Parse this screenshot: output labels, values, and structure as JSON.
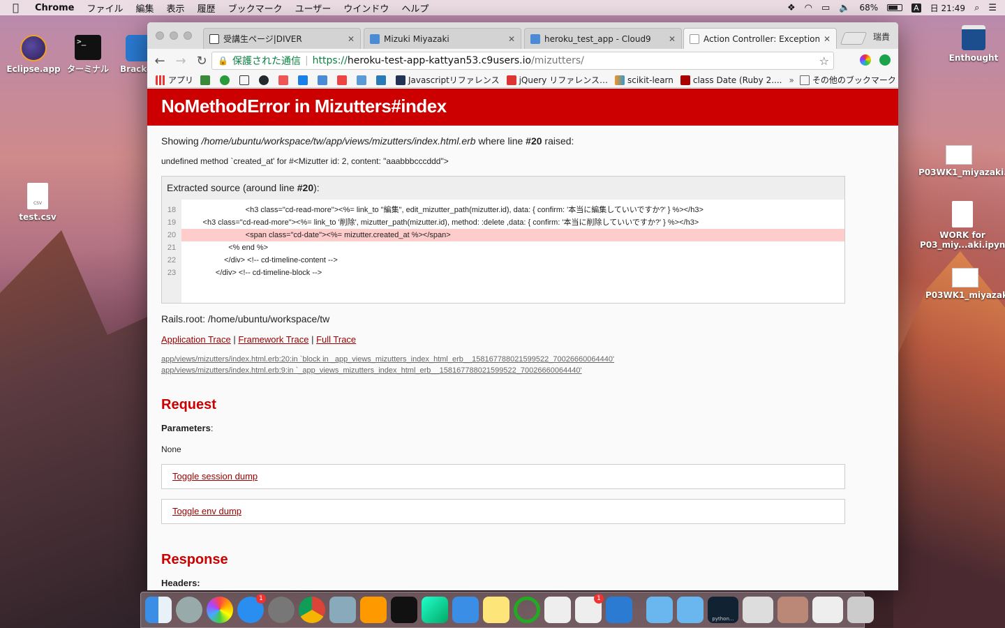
{
  "menubar": {
    "app_name": "Chrome",
    "menus": [
      "ファイル",
      "編集",
      "表示",
      "履歴",
      "ブックマーク",
      "ユーザー",
      "ウインドウ",
      "ヘルプ"
    ],
    "battery_percent": "68%",
    "input_method": "A",
    "clock": "日 21:49"
  },
  "desktop": {
    "icons": [
      {
        "label": "Eclipse.app"
      },
      {
        "label": "ターミナル"
      },
      {
        "label": "Bracke"
      },
      {
        "label": "test.csv",
        "file_tag": "CSV"
      },
      {
        "label": "Enthought"
      },
      {
        "label": "P03WK1_miyazaki.key"
      },
      {
        "label": "WORK for P03_miy...aki.ipynb"
      },
      {
        "label": "P03WK1_miyazaki.pdf"
      }
    ]
  },
  "browser": {
    "profile_name": "瑞貴",
    "tabs": [
      {
        "title": "受講生ページ|DIVER"
      },
      {
        "title": "Mizuki Miyazaki"
      },
      {
        "title": "heroku_test_app - Cloud9"
      },
      {
        "title": "Action Controller: Exception ca"
      }
    ],
    "omnibox": {
      "secure_label": "保護された通信",
      "scheme": "https://",
      "host": "heroku-test-app-kattyan53.c9users.io",
      "path": "/mizutters/"
    },
    "bookmarks": [
      {
        "label": "アプリ"
      },
      {
        "label": "Javascriptリファレンス"
      },
      {
        "label": "jQuery リファレンス…"
      },
      {
        "label": "scikit-learn"
      },
      {
        "label": "class Date (Ruby 2...."
      },
      {
        "label": "その他のブックマーク"
      }
    ]
  },
  "page": {
    "error_title": "NoMethodError in Mizutters#index",
    "showing_prefix": "Showing ",
    "showing_path": "/home/ubuntu/workspace/tw/app/views/mizutters/index.html.erb",
    "showing_mid": " where line ",
    "showing_line": "#20",
    "showing_suffix": " raised:",
    "undefined_message": "undefined method `created_at' for #<Mizutter id: 2, content: \"aaabbbcccddd\">",
    "source_title_prefix": "Extracted source (around line ",
    "source_title_line": "#20",
    "source_title_suffix": "):",
    "source_lines": [
      {
        "num": "18",
        "code": "                              <h3 class=\"cd-read-more\"><%= link_to \"編集\", edit_mizutter_path(mizutter.id), data: { confirm: '本当に編集していいですか?' } %></h3>"
      },
      {
        "num": "19",
        "code": "          <h3 class=\"cd-read-more\"><%= link_to '削除', mizutter_path(mizutter.id), method: :delete ,data: { confirm: '本当に削除していいですか?' } %></h3>"
      },
      {
        "num": "20",
        "code": "                              <span class=\"cd-date\"><%= mizutter.created_at %></span>",
        "highlight": true
      },
      {
        "num": "21",
        "code": "                      <% end %>"
      },
      {
        "num": "22",
        "code": "                    </div> <!-- cd-timeline-content -->"
      },
      {
        "num": "23",
        "code": "                </div> <!-- cd-timeline-block -->"
      }
    ],
    "rails_root": "Rails.root: /home/ubuntu/workspace/tw",
    "trace_links": [
      "Application Trace",
      "Framework Trace",
      "Full Trace"
    ],
    "trace_separator": " | ",
    "trace_lines": [
      "app/views/mizutters/index.html.erb:20:in `block in _app_views_mizutters_index_html_erb__1581677880215995​22_70026660064440'",
      "app/views/mizutters/index.html.erb:9:in `_app_views_mizutters_index_html_erb__158167788021599522_70026660064440'"
    ],
    "request_heading": "Request",
    "parameters_label": "Parameters",
    "parameters_colon": ":",
    "parameters_value": "None",
    "toggle_session": "Toggle session dump",
    "toggle_env": "Toggle env dump",
    "response_heading": "Response",
    "headers_label": "Headers:"
  },
  "dock": {
    "badges": {
      "app_store": "1",
      "slack": "1"
    },
    "labels": {
      "python_window": "python..."
    }
  },
  "colors": {
    "error_red": "#cc0000",
    "link_red": "#990000",
    "highlight_line": "#ffcccc",
    "secure_green": "#0b8043"
  }
}
